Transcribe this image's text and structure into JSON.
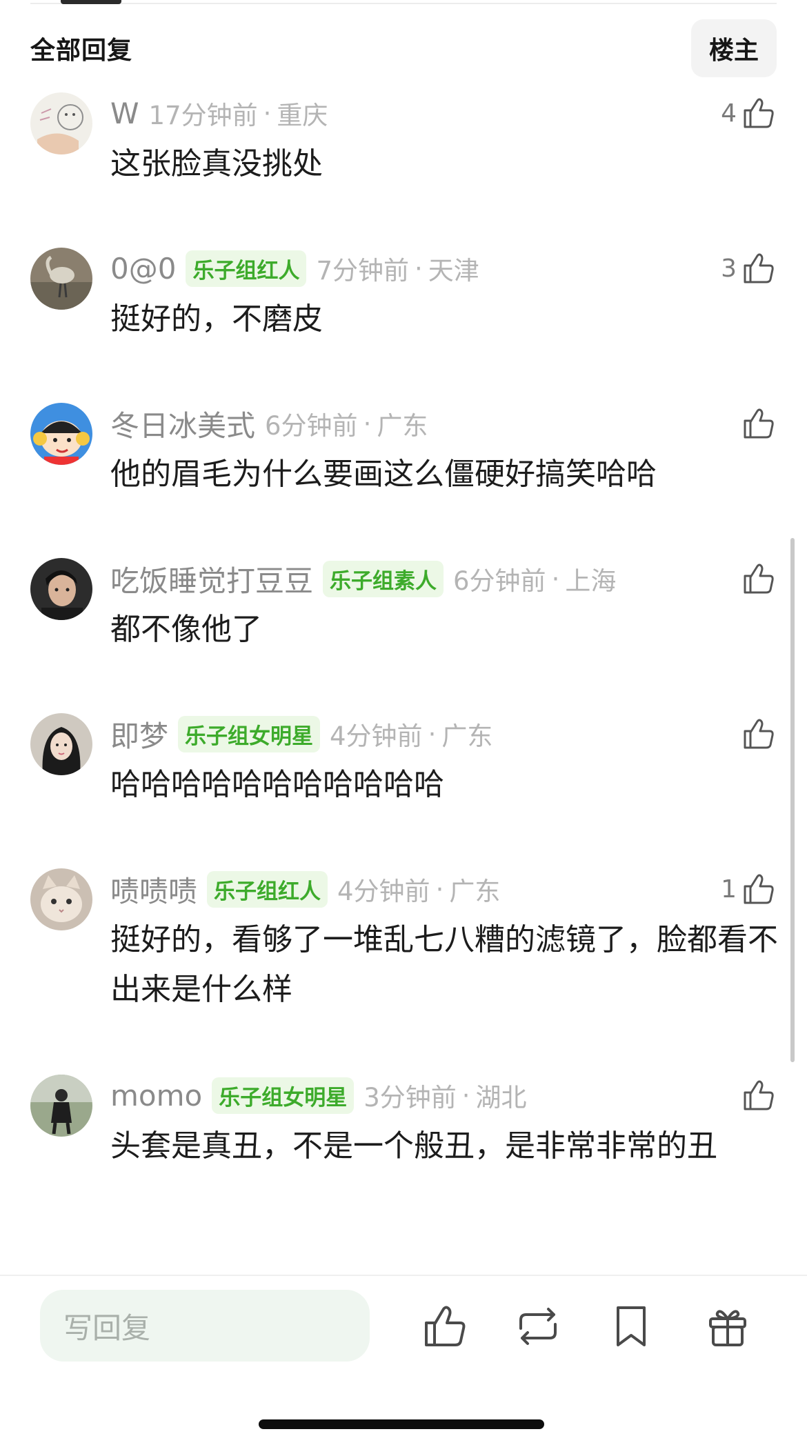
{
  "header": {
    "title": "全部回复",
    "owner_button": "楼主"
  },
  "comments": [
    {
      "user": "W",
      "badge": "",
      "time": "17分钟前",
      "location": "重庆",
      "likes": "4",
      "text": "这张脸真没挑处",
      "avatar": "sketch-avatar"
    },
    {
      "user": "0@0",
      "badge": "乐子组红人",
      "time": "7分钟前",
      "location": "天津",
      "likes": "3",
      "text": "挺好的，不磨皮",
      "avatar": "bird-photo-avatar"
    },
    {
      "user": "冬日冰美式",
      "badge": "",
      "time": "6分钟前",
      "location": "广东",
      "likes": "",
      "text": "他的眉毛为什么要画这么僵硬好搞笑哈哈",
      "avatar": "cartoon-boy-avatar"
    },
    {
      "user": "吃饭睡觉打豆豆",
      "badge": "乐子组素人",
      "time": "6分钟前",
      "location": "上海",
      "likes": "",
      "text": "都不像他了",
      "avatar": "portrait-avatar"
    },
    {
      "user": "即梦",
      "badge": "乐子组女明星",
      "time": "4分钟前",
      "location": "广东",
      "likes": "",
      "text": "哈哈哈哈哈哈哈哈哈哈哈",
      "avatar": "woman-portrait-avatar"
    },
    {
      "user": "啧啧啧",
      "badge": "乐子组红人",
      "time": "4分钟前",
      "location": "广东",
      "likes": "1",
      "text": "挺好的，看够了一堆乱七八糟的滤镜了，脸都看不出来是什么样",
      "avatar": "cat-avatar"
    },
    {
      "user": "momo",
      "badge": "乐子组女明星",
      "time": "3分钟前",
      "location": "湖北",
      "likes": "",
      "text": "头套是真丑，不是一个般丑，是非常非常的丑",
      "avatar": "outdoor-person-avatar"
    }
  ],
  "bottom_bar": {
    "reply_placeholder": "写回复",
    "actions": [
      "like-icon",
      "repost-icon",
      "bookmark-icon",
      "gift-icon"
    ]
  },
  "colors": {
    "badge_text": "#3dab2b",
    "badge_bg": "#ecf8e6",
    "muted": "#b4b4b4"
  }
}
